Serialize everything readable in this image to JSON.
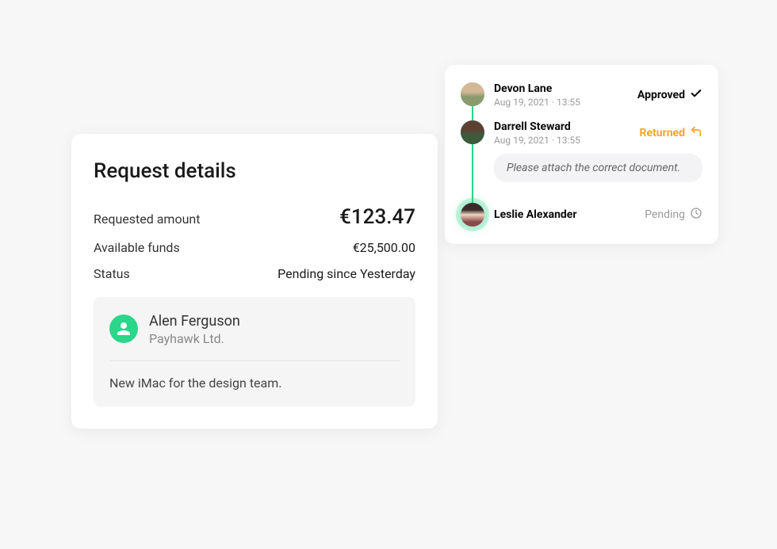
{
  "request": {
    "title": "Request details",
    "labels": {
      "requested_amount": "Requested amount",
      "available_funds": "Available funds",
      "status": "Status"
    },
    "values": {
      "requested_amount": "€123.47",
      "available_funds": "€25,500.00",
      "status": "Pending since Yesterday"
    },
    "requester": {
      "name": "Alen Ferguson",
      "company": "Payhawk Ltd."
    },
    "note": "New iMac for the design team."
  },
  "timeline": {
    "items": [
      {
        "name": "Devon Lane",
        "date": "Aug 19, 2021 · 13:55",
        "status": "Approved"
      },
      {
        "name": "Darrell Steward",
        "date": "Aug 19, 2021 · 13:55",
        "status": "Returned",
        "comment": "Please attach the correct document."
      },
      {
        "name": "Leslie Alexander",
        "status": "Pending"
      }
    ]
  }
}
